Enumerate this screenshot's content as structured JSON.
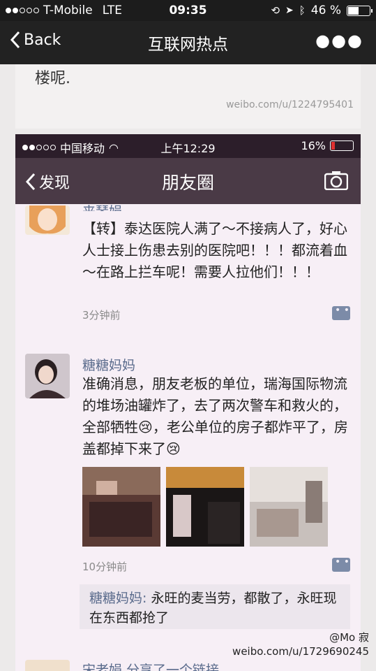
{
  "status": {
    "carrier": "T-Mobile",
    "network": "LTE",
    "time": "09:35",
    "battery": "46 %",
    "battery_level": 0.46
  },
  "nav": {
    "back": "Back",
    "title": "互联网热点"
  },
  "top_card": {
    "text": "楼呢.",
    "watermark": "weibo.com/u/1224795401"
  },
  "inner": {
    "status": {
      "carrier": "中国移动",
      "time": "上午12:29",
      "battery": "16%",
      "battery_level": 0.16
    },
    "nav": {
      "back": "发现",
      "title": "朋友圈"
    },
    "post1": {
      "name": "来琴娟",
      "body": "【转】泰达医院人满了～不接病人了，好心人士接上伤患去别的医院吧！！！都流着血～在路上拦车呢！需要人拉他们！！！",
      "time": "3分钟前"
    },
    "post2": {
      "name": "糖糖妈妈",
      "body": "准确消息，朋友老板的单位，瑞海国际物流的堆场油罐炸了，去了两次警车和救火的，全部牺牲😢，老公单位的房子都炸平了，房盖都掉下来了😢",
      "time": "10分钟前",
      "comment_name": "糖糖妈妈:",
      "comment_text": "永旺的麦当劳，都散了，永旺现在东西都抢了"
    },
    "post3_partial": "宋老娟 分享了一个链接"
  },
  "watermark_bottom": {
    "handle": "@Mo 寂",
    "url": "weibo.com/u/1729690245"
  }
}
